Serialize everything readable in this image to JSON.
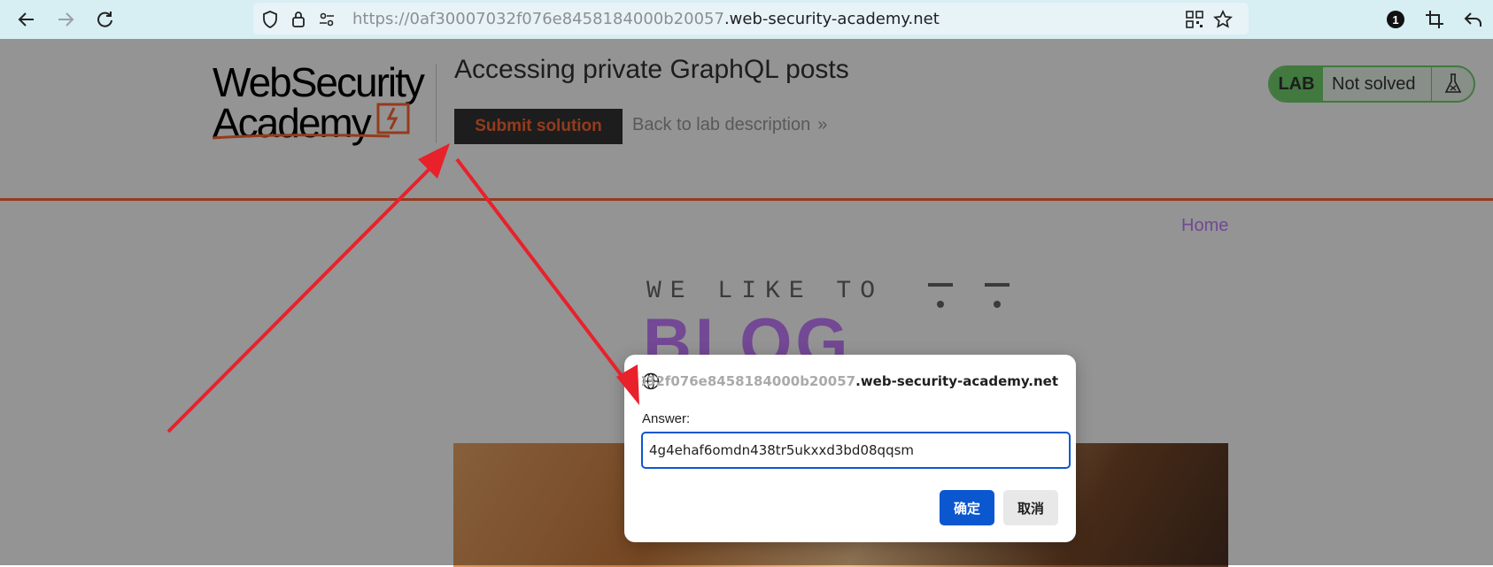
{
  "browser": {
    "url_prefix": "https://0af30007032f076e8458184000b20057",
    "url_domain": ".web-security-academy.net",
    "extension_badge": "1"
  },
  "lab": {
    "logo_line1": "WebSecurity",
    "logo_line2": "Academy",
    "title": "Accessing private GraphQL posts",
    "submit_label": "Submit solution",
    "back_label": "Back to lab description",
    "back_chevron": "»",
    "status_badge": "LAB",
    "status_text": "Not solved",
    "accent_color": "#ff6633"
  },
  "blog": {
    "nav_home": "Home",
    "tagline": "WE LIKE TO",
    "big_word": "BLOG"
  },
  "dialog": {
    "origin_faded": "07032f076e8458184000b20057",
    "origin_rest": ".web-security-academy.net",
    "label": "Answer:",
    "input_value": "4g4ehaf6omdn438tr5ukxxd3bd08qqsm",
    "ok_label": "确定",
    "cancel_label": "取消"
  },
  "annotations": {
    "arrow_color": "#e8212b"
  }
}
